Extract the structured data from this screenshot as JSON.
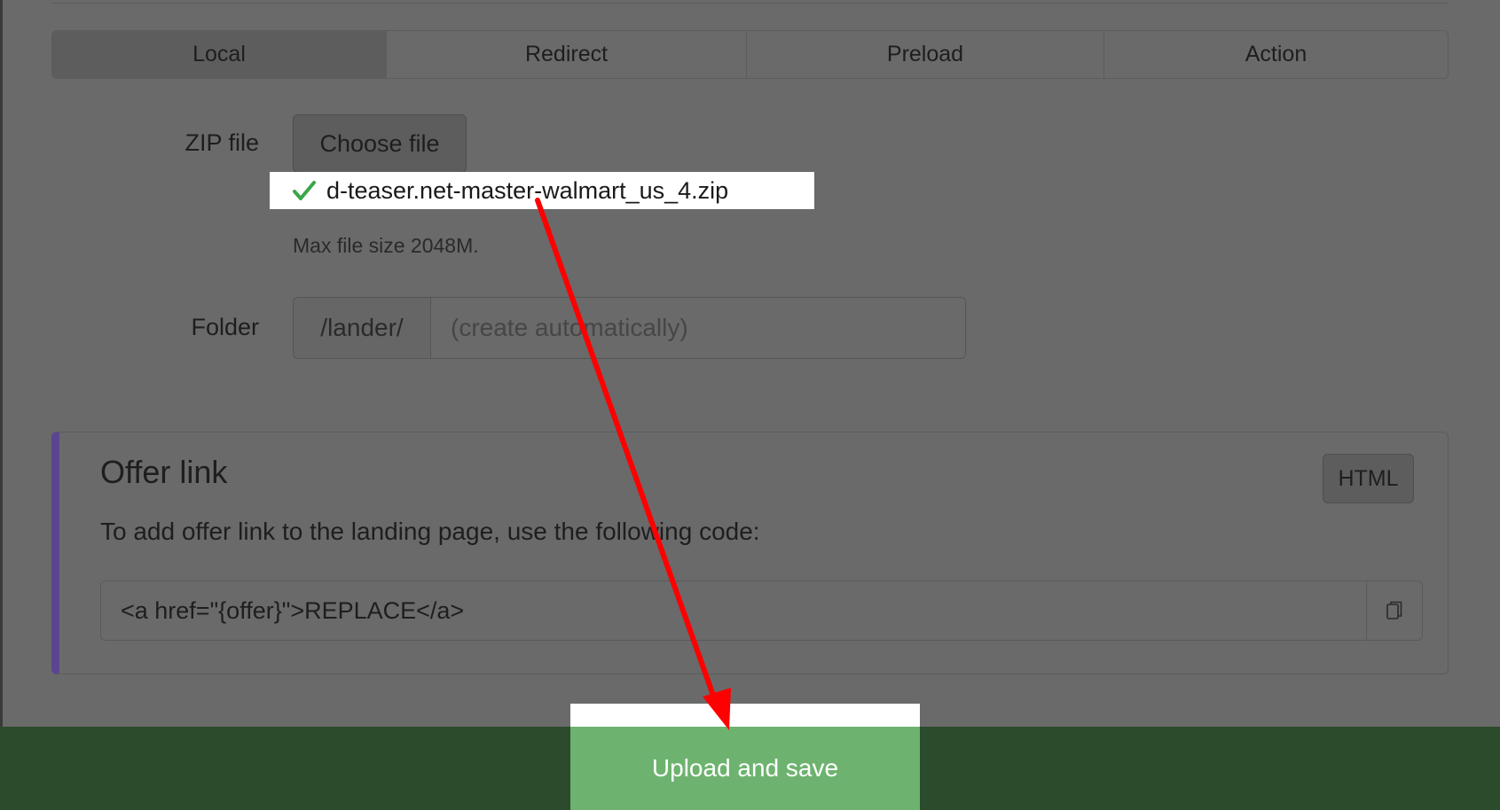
{
  "tabs": [
    {
      "label": "Local",
      "active": true
    },
    {
      "label": "Redirect",
      "active": false
    },
    {
      "label": "Preload",
      "active": false
    },
    {
      "label": "Action",
      "active": false
    }
  ],
  "zip": {
    "label": "ZIP file",
    "choose_button": "Choose file",
    "selected_file": "d-teaser.net-master-walmart_us_4.zip",
    "hint": "Max file size 2048M."
  },
  "folder": {
    "label": "Folder",
    "prefix": "/lander/",
    "placeholder": "(create automatically)",
    "value": ""
  },
  "offer": {
    "title": "Offer link",
    "format_button": "HTML",
    "description": "To add offer link to the landing page, use the following code:",
    "code": "<a href=\"{offer}\">REPLACE</a>"
  },
  "footer": {
    "submit_label": "Upload and save"
  },
  "colors": {
    "accent_border": "#5b4590",
    "submit_bg": "#6db36f",
    "footer_bg": "#2c4a2c",
    "annotation_arrow": "#ff0000",
    "check": "#3aa64a"
  },
  "icons": {
    "check": "check-icon",
    "copy": "copy-icon"
  }
}
